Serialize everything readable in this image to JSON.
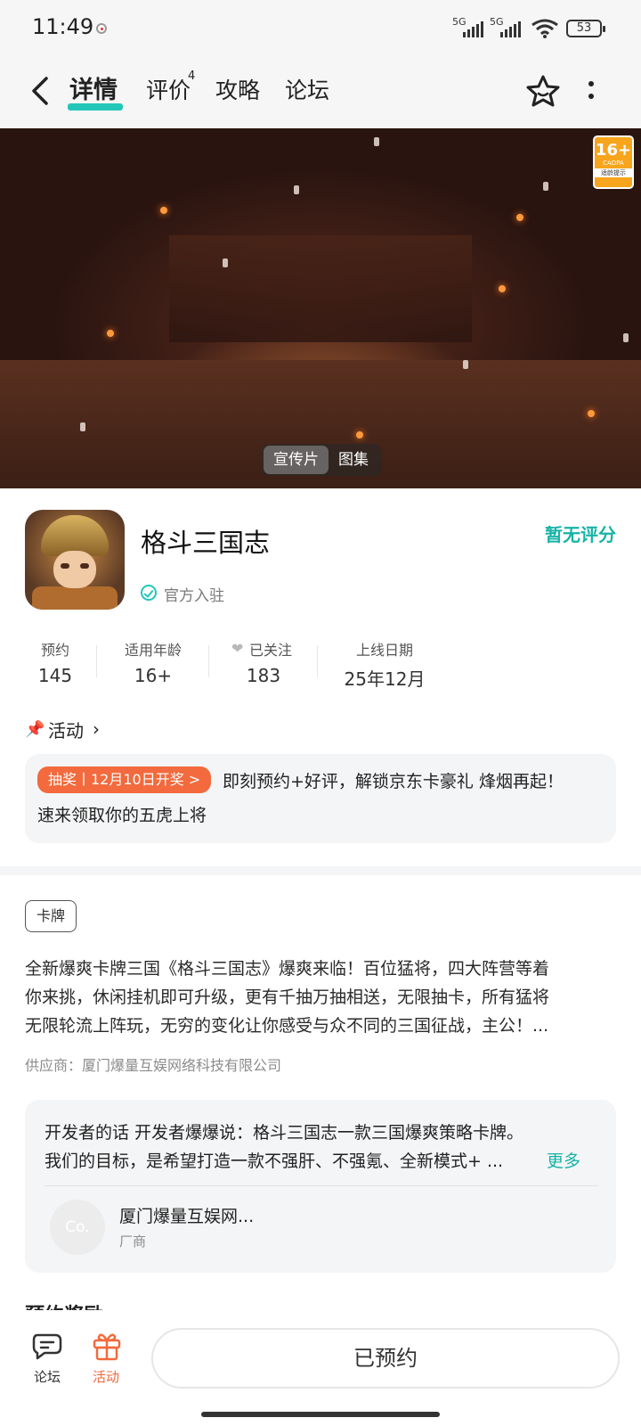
{
  "status_bar": {
    "time": "11:49",
    "signal1_label": "5G",
    "signal2_label": "5G",
    "battery": "53"
  },
  "header": {
    "tabs": [
      {
        "label": "详情"
      },
      {
        "label": "评价",
        "badge": "4"
      },
      {
        "label": "攻略"
      },
      {
        "label": "论坛"
      }
    ],
    "icons": [
      "back-icon",
      "star-icon",
      "more-icon"
    ]
  },
  "banner": {
    "age_badge": {
      "rating": "16+",
      "org": "CADPA",
      "hint": "适龄提示"
    },
    "media_tabs": [
      "宣传片",
      "图集"
    ]
  },
  "game": {
    "title": "格斗三国志",
    "rating_text": "暂无评分",
    "official_label": "官方入驻",
    "stats": [
      {
        "label": "预约",
        "value": "145"
      },
      {
        "label": "适用年龄",
        "value": "16+"
      },
      {
        "label": "已关注",
        "value": "183"
      },
      {
        "label": "上线日期",
        "value": "25年12月"
      }
    ]
  },
  "activity": {
    "title": "活动",
    "tag": "抽奖丨12月10日开奖 >",
    "text_line1": "即刻预约+好评，解锁京东卡豪礼 烽烟再起！",
    "text_line2": "速来领取你的五虎上将"
  },
  "description": {
    "tag": "卡牌",
    "lines": [
      "全新爆爽卡牌三国《格斗三国志》爆爽来临！百位猛将，四大阵营等着",
      "你来挑，休闲挂机即可升级，更有千抽万抽相送，无限抽卡，所有猛将",
      "无限轮流上阵玩，无穷的变化让你感受与众不同的三国征战，主公！..."
    ],
    "supplier": "供应商：厦门爆量互娱网络科技有限公司"
  },
  "developer": {
    "line1": "开发者的话  开发者爆爆说：格斗三国志一款三国爆爽策略卡牌。",
    "line2": "我们的目标，是希望打造一款不强肝、不强氪、全新模式+ ...",
    "more": "更多",
    "avatar_text": "Co.",
    "name": "厦门爆量互娱网...",
    "role": "厂商"
  },
  "cut_heading": "预约奖励",
  "bottom_nav": {
    "forum_label": "论坛",
    "activity_label": "活动",
    "action_button": "已预约"
  },
  "colors": {
    "accent": "#22c7b8",
    "orange": "#f26a3d",
    "card_bg": "#f4f5f7"
  }
}
